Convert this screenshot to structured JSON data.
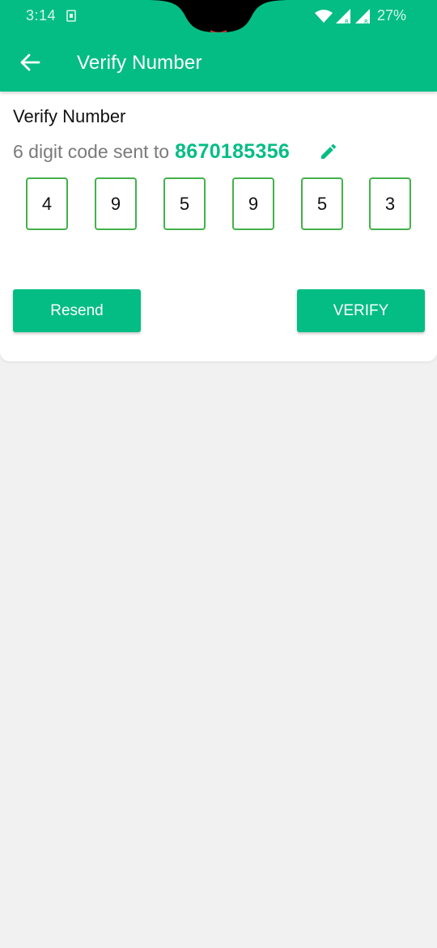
{
  "status_bar": {
    "time": "3:14",
    "battery": "27%",
    "icons": [
      "sim-card-icon",
      "wifi-icon",
      "signal-icon",
      "signal-icon"
    ]
  },
  "app_bar": {
    "back_icon": "arrow-left-icon",
    "title": "Verify Number"
  },
  "card": {
    "title": "Verify Number",
    "sent_text": "6 digit code sent to",
    "phone_number": "8670185356",
    "edit_icon": "pencil-icon"
  },
  "otp": {
    "digits": [
      "4",
      "9",
      "5",
      "9",
      "5",
      "3"
    ]
  },
  "actions": {
    "resend_label": "Resend",
    "verify_label": "VERIFY"
  },
  "colors": {
    "primary": "#04bd84",
    "otp_border": "#44b14a",
    "background": "#f1f1f1",
    "secondary_text": "#7a7a7a"
  }
}
